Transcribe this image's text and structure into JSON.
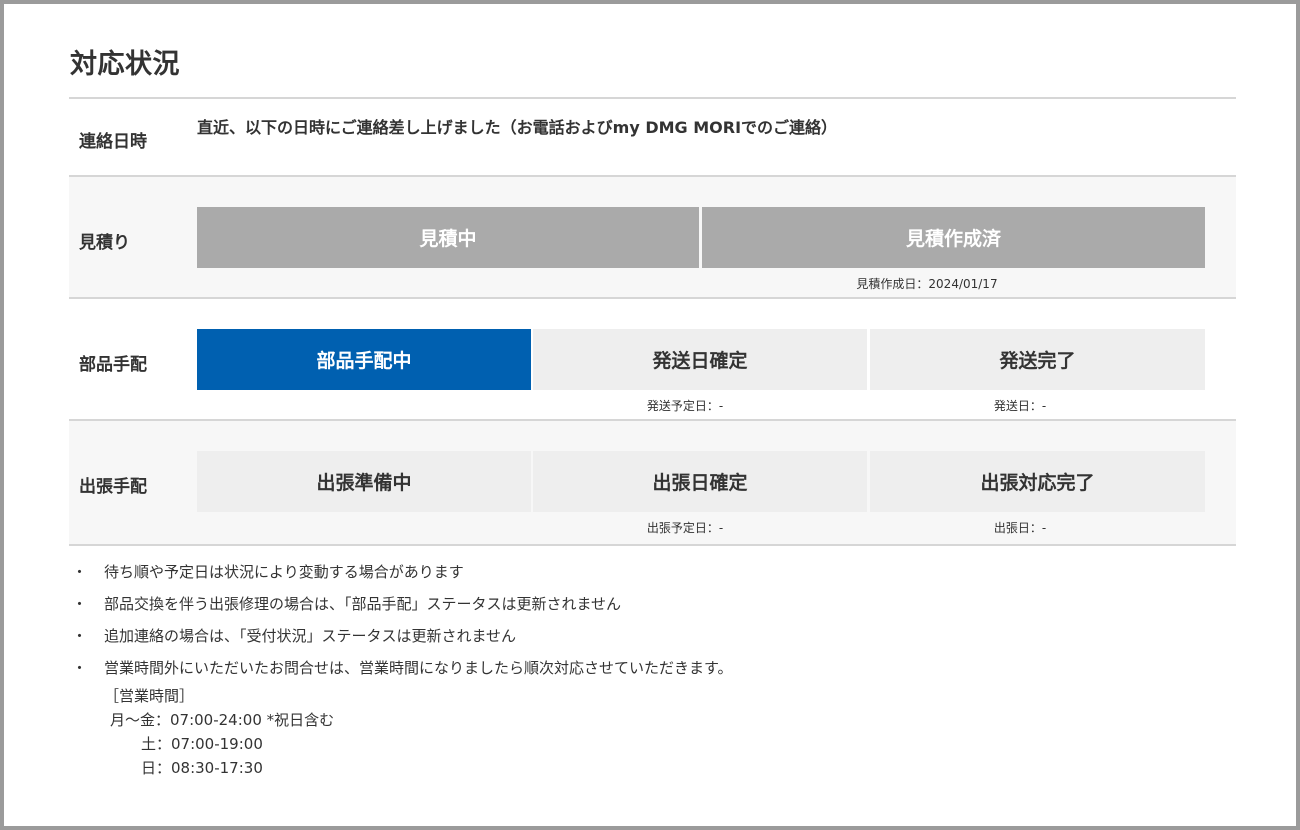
{
  "page": {
    "title": "対応状況"
  },
  "contact": {
    "label": "連絡日時",
    "text": "直近、以下の日時にご連絡差し上げました（お電話およびmy DMG MORIでのご連絡）"
  },
  "estimate": {
    "label": "見積り",
    "steps": [
      {
        "label": "見積中",
        "state": "done",
        "note": ""
      },
      {
        "label": "見積作成済",
        "state": "done",
        "note": "見積作成日：2024/01/17"
      }
    ]
  },
  "parts": {
    "label": "部品手配",
    "steps": [
      {
        "label": "部品手配中",
        "state": "active",
        "note": ""
      },
      {
        "label": "発送日確定",
        "state": "pending",
        "note": "発送予定日：-"
      },
      {
        "label": "発送完了",
        "state": "pending",
        "note": "発送日：-"
      }
    ]
  },
  "dispatch": {
    "label": "出張手配",
    "steps": [
      {
        "label": "出張準備中",
        "state": "pending",
        "note": ""
      },
      {
        "label": "出張日確定",
        "state": "pending",
        "note": "出張予定日：-"
      },
      {
        "label": "出張対応完了",
        "state": "pending",
        "note": "出張日：-"
      }
    ]
  },
  "colors": {
    "active": "#0060b0",
    "done": "#aaaaaa",
    "pending": "#eeeeee"
  },
  "notes": {
    "bullet": "・",
    "items": [
      "待ち順や予定日は状況により変動する場合があります",
      "部品交換を伴う出張修理の場合は、「部品手配」ステータスは更新されません",
      "追加連絡の場合は、「受付状況」ステータスは更新されません",
      "営業時間外にいただいたお問合せは、営業時間になりましたら順次対応させていただきます。"
    ]
  },
  "hours": {
    "heading": "［営業時間］",
    "weekday": "月～金：07:00-24:00 *祝日含む",
    "saturday": "土：07:00-19:00",
    "sunday": "日：08:30-17:30"
  }
}
